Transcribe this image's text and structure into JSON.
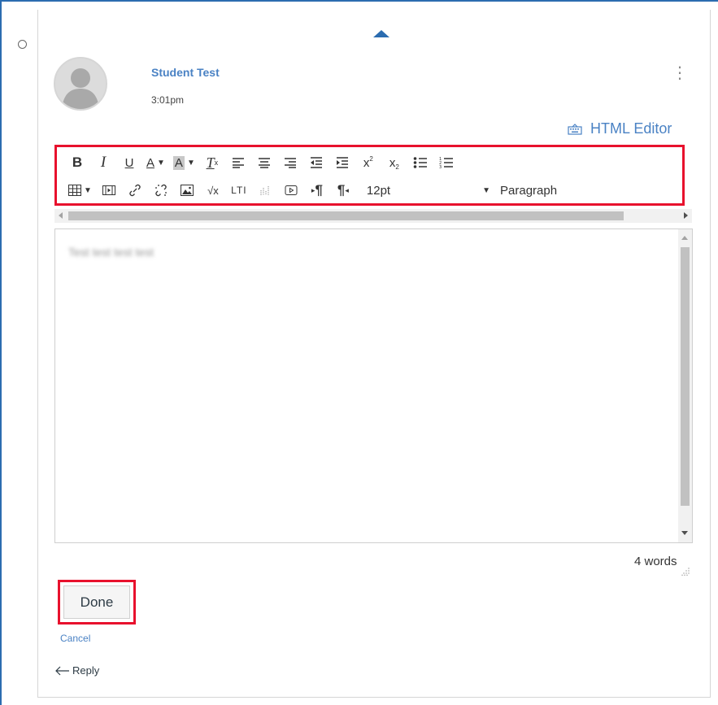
{
  "post": {
    "author": "Student Test",
    "time": "3:01pm"
  },
  "editor": {
    "html_editor_label": "HTML Editor",
    "font_size": "12pt",
    "block_format": "Paragraph",
    "body_text": "Test test test test",
    "word_count": "4 words"
  },
  "toolbar": {
    "bold": "B",
    "italic": "I",
    "underline": "U",
    "text_color": "A",
    "bg_color": "A",
    "clear_format": "T",
    "ltr": "¶",
    "rtl": "¶",
    "lti": "LTI",
    "math": "√x"
  },
  "actions": {
    "done": "Done",
    "cancel": "Cancel",
    "reply": "Reply"
  },
  "colors": {
    "accent": "#4a82c4",
    "highlight": "#e8112d",
    "frame": "#2b6cb0"
  }
}
